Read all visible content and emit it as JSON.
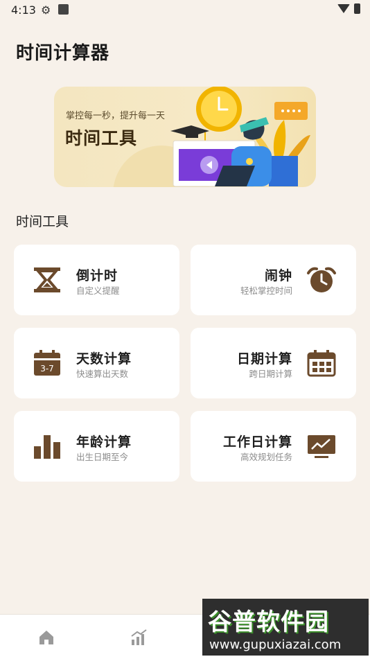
{
  "status": {
    "time": "4:13"
  },
  "page": {
    "title": "时间计算器"
  },
  "banner": {
    "subtitle": "掌控每一秒，提升每一天",
    "title": "时间工具"
  },
  "section": {
    "title": "时间工具"
  },
  "tools": [
    {
      "title": "倒计时",
      "subtitle": "自定义提醒",
      "icon": "hourglass-icon"
    },
    {
      "title": "闹钟",
      "subtitle": "轻松掌控时间",
      "icon": "alarm-clock-icon"
    },
    {
      "title": "天数计算",
      "subtitle": "快速算出天数",
      "icon": "calendar-day-icon",
      "badge": "3-7"
    },
    {
      "title": "日期计算",
      "subtitle": "跨日期计算",
      "icon": "calendar-grid-icon"
    },
    {
      "title": "年龄计算",
      "subtitle": "出生日期至今",
      "icon": "bar-chart-icon"
    },
    {
      "title": "工作日计算",
      "subtitle": "高效规划任务",
      "icon": "monitor-chart-icon"
    }
  ],
  "nav": [
    {
      "icon": "home-icon"
    },
    {
      "icon": "stats-icon"
    },
    {
      "icon": "calendar-icon"
    },
    {
      "icon": "profile-icon"
    }
  ],
  "watermark": {
    "title": "谷普软件园",
    "url": "www.gupuxiazai.com"
  },
  "colors": {
    "icon_brown": "#6b4a2c",
    "background": "#f7f1ea",
    "banner": "#f4e6c0"
  }
}
